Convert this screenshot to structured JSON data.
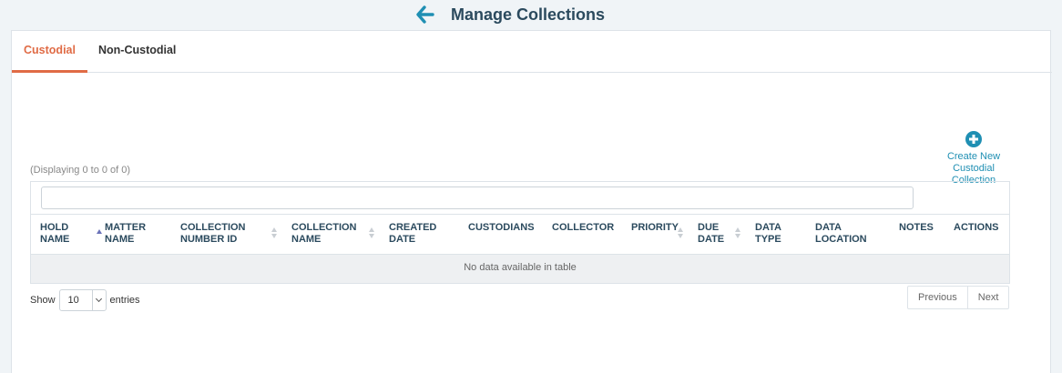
{
  "header": {
    "title": "Manage Collections",
    "back_icon": "arrow-left-icon",
    "accent": "#1f8fb3"
  },
  "tabs": [
    {
      "label": "Custodial",
      "active": true
    },
    {
      "label": "Non-Custodial",
      "active": false
    }
  ],
  "create_button": {
    "icon": "plus-circle-icon",
    "lines": [
      "Create New",
      "Custodial",
      "Collection"
    ]
  },
  "table": {
    "displaying": "(Displaying 0 to 0 of 0)",
    "search_value": "",
    "columns": [
      {
        "line1": "HOLD",
        "line2": "NAME"
      },
      {
        "line1": "MATTER",
        "line2": "NAME"
      },
      {
        "line1": "COLLECTION",
        "line2": "NUMBER ID"
      },
      {
        "line1": "COLLECTION",
        "line2": "NAME"
      },
      {
        "line1": "CREATED",
        "line2": "DATE"
      },
      {
        "line1": "CUSTODIANS",
        "line2": ""
      },
      {
        "line1": "COLLECTOR",
        "line2": ""
      },
      {
        "line1": "PRIORITY",
        "line2": ""
      },
      {
        "line1": "DUE",
        "line2": "DATE"
      },
      {
        "line1": "DATA",
        "line2": "TYPE"
      },
      {
        "line1": "DATA",
        "line2": "LOCATION"
      },
      {
        "line1": "NOTES",
        "line2": ""
      },
      {
        "line1": "ACTIONS",
        "line2": ""
      }
    ],
    "empty_message": "No data available in table"
  },
  "length": {
    "prefix": "Show",
    "value": "10",
    "suffix": "entries"
  },
  "pagination": {
    "previous": "Previous",
    "next": "Next"
  },
  "colors": {
    "active_tab": "#e06b45",
    "title": "#2b4a5e",
    "link": "#1f8fb3"
  }
}
